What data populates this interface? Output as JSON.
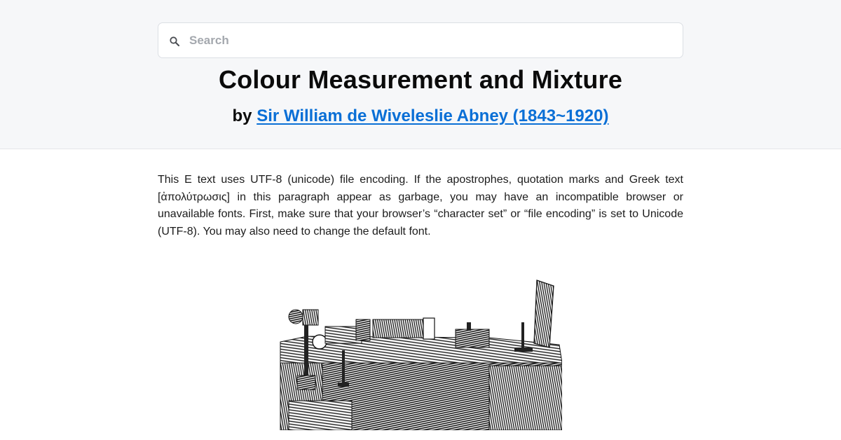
{
  "search": {
    "placeholder": "Search",
    "icon": "search-icon"
  },
  "header": {
    "title": "Colour Measurement and Mixture",
    "by_prefix": "by",
    "author_link": "Sir William de Wiveleslie Abney (1843~1920)"
  },
  "notice": {
    "text": "This E text uses UTF-8 (unicode) file encoding. If the apostrophes, quotation marks and Greek text [ἀπολύτρωσις] in this paragraph appear as garbage, you may have an incompatible browser or unavailable fonts. First, make sure that your browser’s “character set” or “file encoding” is set to Unicode (UTF-8). You may also need to change the default font."
  },
  "colors": {
    "header_background": "#f6f7f9",
    "link": "#0a6fd6",
    "text": "#111111"
  }
}
